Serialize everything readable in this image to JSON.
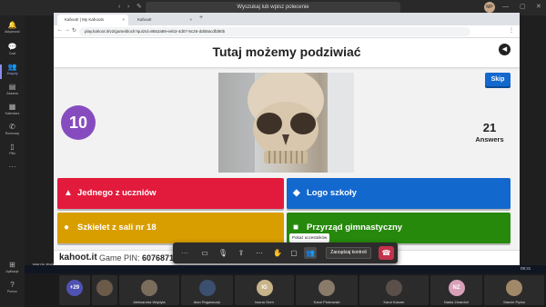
{
  "teams": {
    "search_placeholder": "Wyszukaj lub wpisz polecenie",
    "user_initials": "MP",
    "presenter_name": "Marcin Pyrka",
    "rail": [
      {
        "label": "Aktywność",
        "icon": "bell-icon",
        "glyph": "🔔"
      },
      {
        "label": "Czat",
        "icon": "chat-icon",
        "glyph": "💬"
      },
      {
        "label": "Zespoły",
        "icon": "teams-icon",
        "glyph": "👥",
        "active": true
      },
      {
        "label": "Zadania",
        "icon": "assignments-icon",
        "glyph": "▤"
      },
      {
        "label": "Kalendarz",
        "icon": "calendar-icon",
        "glyph": "▦"
      },
      {
        "label": "Rozmowy",
        "icon": "phone-icon",
        "glyph": "✆"
      },
      {
        "label": "Pliki",
        "icon": "files-icon",
        "glyph": "▯"
      },
      {
        "label": "···",
        "icon": "more-icon",
        "glyph": "···"
      },
      {
        "label": "Aplikacje",
        "icon": "apps-icon",
        "glyph": "⊞"
      },
      {
        "label": "Pomoc",
        "icon": "help-icon",
        "glyph": "?"
      }
    ]
  },
  "browser": {
    "tabs": [
      {
        "label": "Kahoot! | My Kahoots",
        "active": true
      },
      {
        "label": "Kahoot!",
        "active": false
      }
    ],
    "url": "play.kahoot.it/v2/gameblock?quizId=8652a89-eeb3-4d07-8c26-dd08acdfd90b"
  },
  "kahoot": {
    "question": "Tutaj możemy podziwiać",
    "skip_label": "Skip",
    "timer": "10",
    "answers_count": "21",
    "answers_label": "Answers",
    "answers": [
      {
        "text": "Jednego z uczniów",
        "shape": "▲",
        "shape_name": "triangle-icon",
        "color": "#e21b3c"
      },
      {
        "text": "Logo szkoły",
        "shape": "◆",
        "shape_name": "diamond-icon",
        "color": "#1368ce"
      },
      {
        "text": "Szkielet z sali nr 18",
        "shape": "●",
        "shape_name": "circle-icon",
        "color": "#d89e00"
      },
      {
        "text": "Przyrząd gimnastyczny",
        "shape": "■",
        "shape_name": "square-icon",
        "color": "#26890c"
      }
    ],
    "footer_logo": "kahoot.it",
    "pin_label": "Game PIN:",
    "pin": "6076871"
  },
  "meeting": {
    "tooltip": "Pokaż uczestników",
    "manage_label": "Zarządzaj kontroli",
    "participants": [
      {
        "name": "",
        "initials": "+29",
        "color": "#4f52b2"
      },
      {
        "name": "",
        "initials": "",
        "color": "#6b5a4a"
      },
      {
        "name": "Aleksandra Wojdyła",
        "initials": "",
        "color": "#7a6d5c"
      },
      {
        "name": "Alan Rogawczyk",
        "initials": "",
        "color": "#3c4f6e"
      },
      {
        "name": "Iwona Greń",
        "initials": "IG",
        "color": "#c8b48a"
      },
      {
        "name": "Karol Piotrowski",
        "initials": "",
        "color": "#8a7a6a"
      },
      {
        "name": "Karol Kasner",
        "initials": "",
        "color": "#5a5049"
      },
      {
        "name": "Nadia Zwardoń",
        "initials": "NZ",
        "color": "#d8a0b8"
      },
      {
        "name": "Marcin Pyrka",
        "initials": "",
        "color": "#a08868"
      }
    ]
  },
  "taskbar": {
    "time": "09:31"
  }
}
